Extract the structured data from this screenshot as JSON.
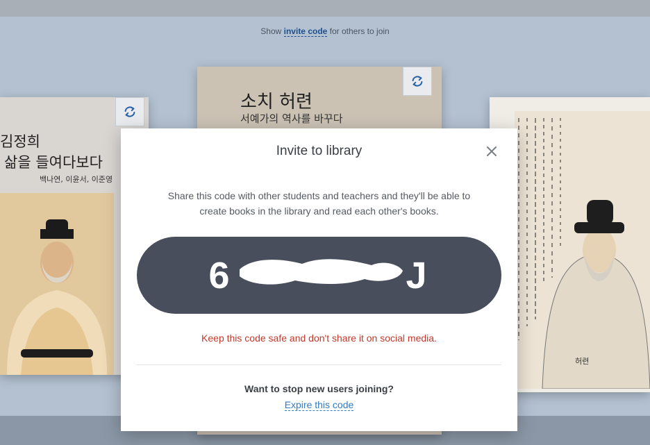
{
  "header": {
    "show_prefix": "Show ",
    "invite_link": "invite code",
    "show_suffix": " for others to join"
  },
  "books": {
    "left": {
      "title_line1": "김정희",
      "title_line2": "삶을 들여다보다",
      "authors": "백나연, 이윤서, 이준영"
    },
    "center": {
      "title_line1": "소치 허련",
      "title_line2": "서예가의 역사를 바꾸다"
    },
    "right": {
      "portrait_caption": "허련"
    }
  },
  "modal": {
    "title": "Invite to library",
    "description": "Share this code with other students and teachers and they'll be able to create books in the library and read each other's books.",
    "code_first": "6",
    "code_last": "J",
    "warning": "Keep this code safe and don't share it on social media.",
    "stop_question": "Want to stop new users joining?",
    "expire_link": "Expire this code"
  },
  "colors": {
    "code_pill": "#494e5c",
    "warning": "#c0392b",
    "link": "#2f7cc1"
  },
  "icons": {
    "rotate": "rotate-icon",
    "close": "close-icon"
  }
}
